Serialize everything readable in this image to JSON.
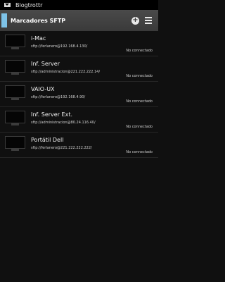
{
  "statusbar": {
    "title": "Blogtrottr",
    "icon": "mail-icon"
  },
  "actionbar": {
    "title": "Marcadores SFTP",
    "add_icon": "add-icon",
    "menu_icon": "menu-icon",
    "add_symbol": "+"
  },
  "bookmarks": [
    {
      "name": "i-Mac",
      "path": "sftp://ferlanero@192.168.4.130/",
      "status": "No connectado"
    },
    {
      "name": "Inf. Server",
      "path": "sftp://administracion@221.222.222.14/",
      "status": "No connectado"
    },
    {
      "name": "VAIO-UX",
      "path": "sftp://ferlanero@192.168.4.90/",
      "status": "No connectado"
    },
    {
      "name": "Inf. Server Ext.",
      "path": "sftp://administracion@80.24.116.40/",
      "status": "No connectado"
    },
    {
      "name": "Portátil Dell",
      "path": "sftp://ferlanero@221.222.222.222/",
      "status": "No connectado"
    }
  ]
}
